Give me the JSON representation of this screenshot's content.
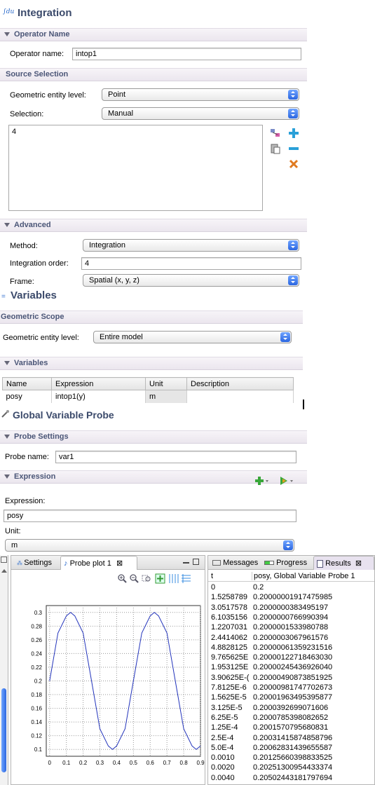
{
  "integration": {
    "title": "Integration",
    "title_glyph": "∫du",
    "operator_section": "Operator Name",
    "operator_label": "Operator name:",
    "operator_value": "intop1",
    "source_section": "Source Selection",
    "geom_label": "Geometric entity level:",
    "geom_value": "Point",
    "selection_label": "Selection:",
    "selection_value": "Manual",
    "selection_list": [
      "4"
    ],
    "advanced_section": "Advanced",
    "method_label": "Method:",
    "method_value": "Integration",
    "order_label": "Integration order:",
    "order_value": "4",
    "frame_label": "Frame:",
    "frame_value": "Spatial  (x, y, z)"
  },
  "variables": {
    "title": "Variables",
    "scope_section": "Geometric Scope",
    "geom_label": "Geometric entity level:",
    "geom_value": "Entire model",
    "vars_section": "Variables",
    "columns": [
      "Name",
      "Expression",
      "Unit",
      "Description"
    ],
    "rows": [
      {
        "name": "posy",
        "expression": "intop1(y)",
        "unit": "m",
        "description": ""
      }
    ]
  },
  "probe": {
    "title": "Global Variable Probe",
    "settings_section": "Probe Settings",
    "name_label": "Probe name:",
    "name_value": "var1",
    "expression_section": "Expression",
    "expression_label": "Expression:",
    "expression_value": "posy",
    "unit_label": "Unit:",
    "unit_value": "m"
  },
  "bottom": {
    "tabs_left": [
      "Settings",
      "Probe plot 1"
    ],
    "tabs_right": [
      "Messages",
      "Progress",
      "Results"
    ],
    "results_columns": [
      "t",
      "posy, Global Variable Probe 1"
    ],
    "results_rows": [
      [
        "0",
        "0.2"
      ],
      [
        "1.5258789",
        "0.20000001917475985"
      ],
      [
        "3.0517578",
        "0.2000000383495197"
      ],
      [
        "6.1035156",
        "0.2000000766990394"
      ],
      [
        "1.2207031",
        "0.2000001533980788"
      ],
      [
        "2.4414062",
        "0.2000003067961576"
      ],
      [
        "4.8828125",
        "0.20000061359231516"
      ],
      [
        "9.765625E",
        "0.20000122718463030"
      ],
      [
        "1.953125E",
        "0.20000245436926040"
      ],
      [
        "3.90625E-(",
        "0.20000490873851925"
      ],
      [
        "7.8125E-6",
        "0.20000981747702673"
      ],
      [
        "1.5625E-5",
        "0.20001963495395877"
      ],
      [
        "3.125E-5",
        "0.2000392699071606"
      ],
      [
        "6.25E-5",
        "0.2000785398082652"
      ],
      [
        "1.25E-4",
        "0.2001570795680831"
      ],
      [
        "2.5E-4",
        "0.20031415874858796"
      ],
      [
        "5.0E-4",
        "0.20062831439655587"
      ],
      [
        "0.0010",
        "0.20125660398833525"
      ],
      [
        "0.0020",
        "0.20251300954433374"
      ],
      [
        "0.0040",
        "0.20502443181797694"
      ]
    ]
  },
  "chart_data": {
    "type": "line",
    "title": "",
    "xlabel": "",
    "ylabel": "",
    "xlim": [
      -0.02,
      0.9
    ],
    "ylim": [
      0.09,
      0.31
    ],
    "xticks": [
      "0",
      "0.1",
      "0.2",
      "0.3",
      "0.4",
      "0.5",
      "0.6",
      "0.7",
      "0.8",
      "0.9"
    ],
    "yticks": [
      "0.1",
      "0.12",
      "0.14",
      "0.16",
      "0.18",
      "0.2",
      "0.22",
      "0.24",
      "0.26",
      "0.28",
      "0.3"
    ],
    "grid": true,
    "color": "#2233bb",
    "series": [
      {
        "x": [
          0,
          0.05,
          0.1,
          0.125,
          0.15,
          0.2,
          0.25,
          0.3,
          0.35,
          0.375,
          0.4,
          0.45,
          0.5,
          0.55,
          0.6,
          0.625,
          0.65,
          0.7,
          0.75,
          0.8,
          0.85,
          0.875,
          0.9
        ],
        "y": [
          0.2,
          0.27,
          0.295,
          0.3,
          0.295,
          0.27,
          0.2,
          0.13,
          0.105,
          0.1,
          0.105,
          0.13,
          0.2,
          0.27,
          0.295,
          0.3,
          0.295,
          0.27,
          0.2,
          0.13,
          0.105,
          0.1,
          0.105
        ]
      }
    ]
  }
}
